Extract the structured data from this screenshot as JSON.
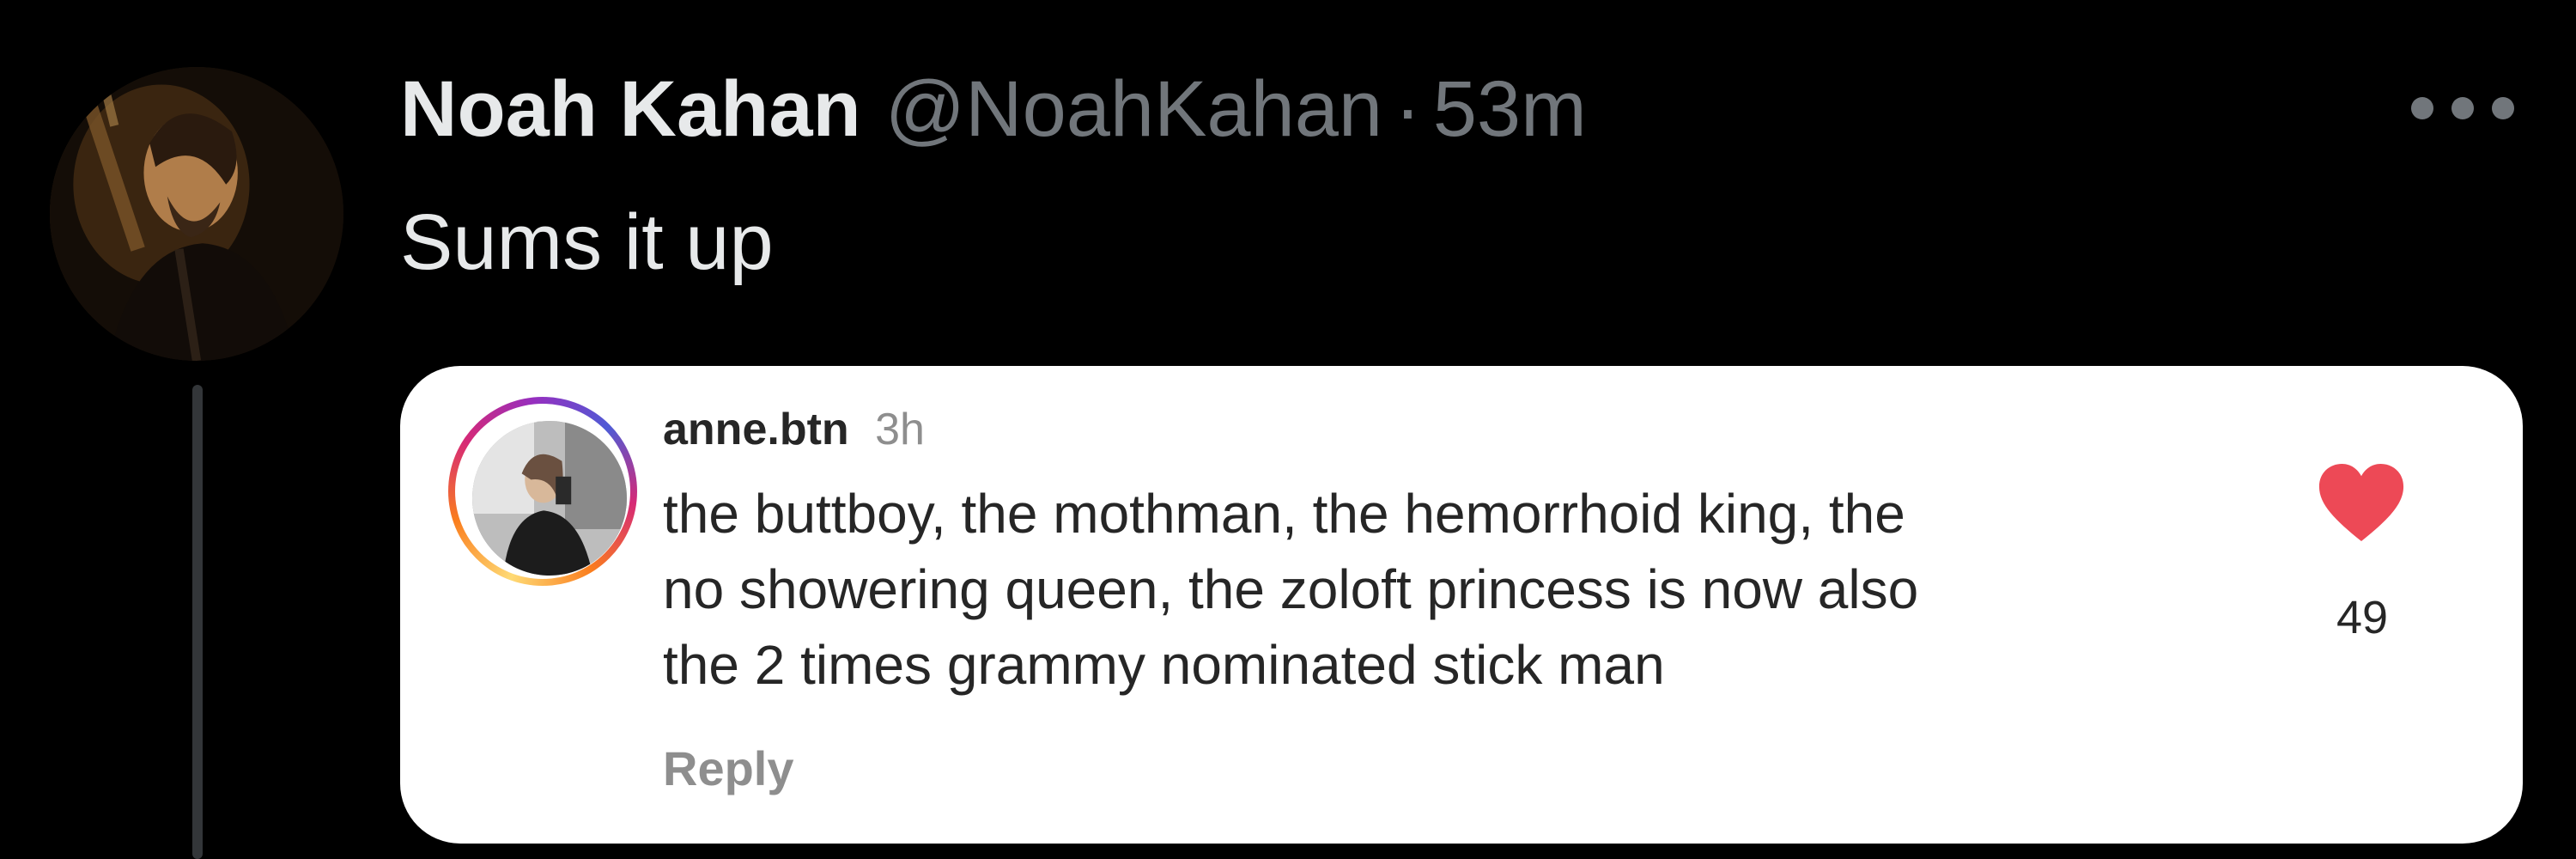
{
  "tweet": {
    "display_name": "Noah Kahan",
    "handle": "@NoahKahan",
    "separator": "·",
    "time": "53m",
    "text": "Sums it up",
    "more_icon": "more-horizontal-icon"
  },
  "quoted_comment": {
    "username": "anne.btn",
    "time": "3h",
    "lines": [
      "the buttboy, the mothman, the hemorrhoid king, the",
      "no showering queen, the zoloft princess is now also",
      "the 2 times grammy nominated stick man"
    ],
    "reply_label": "Reply",
    "like_icon": "heart-icon",
    "like_count": "49"
  },
  "colors": {
    "background": "#000000",
    "primary_text": "#e7e9ea",
    "secondary_text": "#71767b",
    "card_background": "#ffffff",
    "heart": "#ed4956"
  }
}
